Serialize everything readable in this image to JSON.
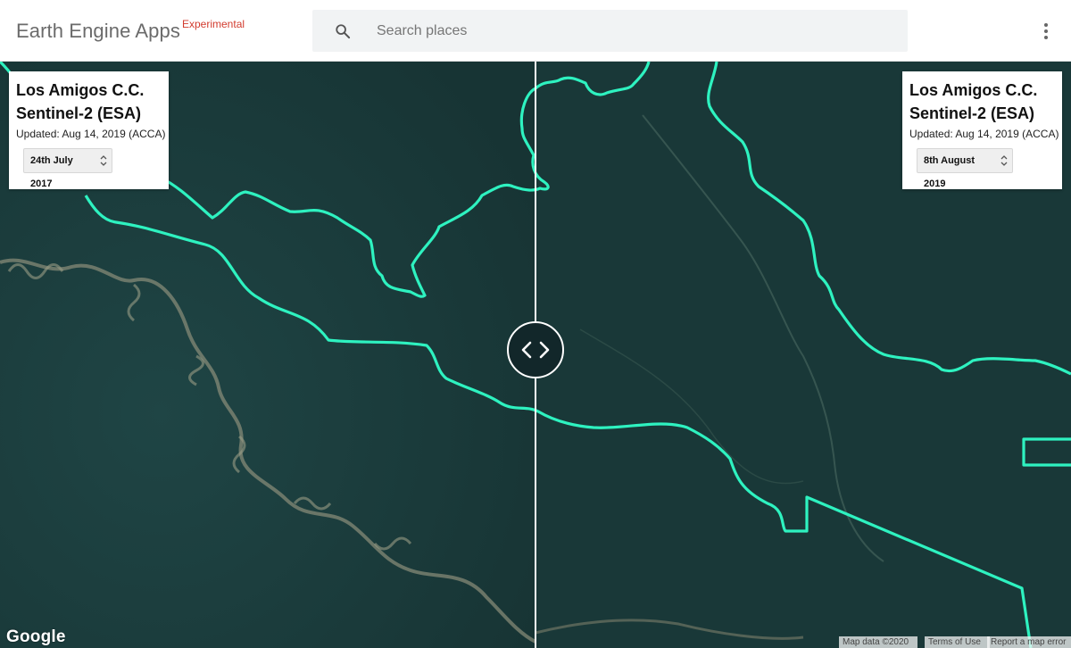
{
  "header": {
    "brand": "Earth Engine Apps",
    "brand_tag": "Experimental",
    "search_placeholder": "Search places",
    "icons": {
      "search": "search-icon",
      "menu": "more-vert-icon"
    }
  },
  "panels": {
    "left": {
      "title_line1": "Los Amigos C.C.",
      "title_line2": "Sentinel-2 (ESA)",
      "updated": "Updated: Aug 14, 2019 (ACCA)",
      "date": "24th July 2017"
    },
    "right": {
      "title_line1": "Los Amigos C.C.",
      "title_line2": "Sentinel-2 (ESA)",
      "updated": "Updated: Aug 14, 2019 (ACCA)",
      "date": "8th August 2019"
    }
  },
  "map": {
    "boundary_color": "#2ef2c0",
    "forest_color": "#1b3b3b",
    "handle_icon": "code-arrows-icon",
    "google_logo": "Google",
    "attribution": {
      "map_data": "Map data ©2020",
      "terms": "Terms of Use",
      "report": "Report a map error"
    }
  }
}
